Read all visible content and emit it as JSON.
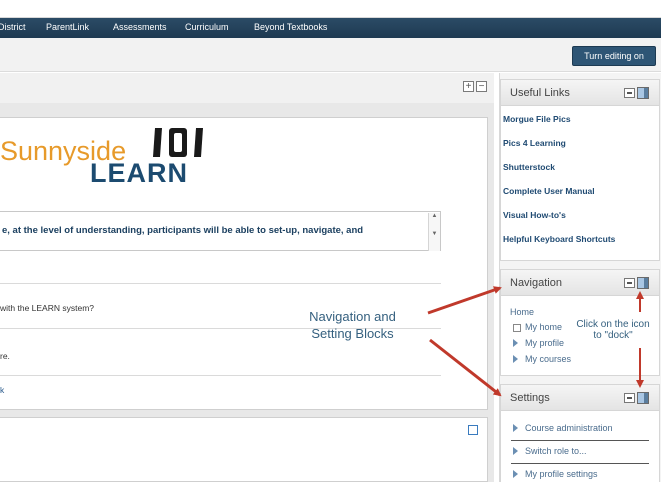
{
  "navbar": {
    "items": [
      "District",
      "ParentLink",
      "Assessments",
      "Curriculum",
      "Beyond Textbooks"
    ]
  },
  "toolbar": {
    "edit_button": "Turn editing on"
  },
  "course": {
    "logo_text_1": "Sunnyside",
    "logo_text_2": "101",
    "logo_text_3": "LEARN",
    "objective": "e, at the level of understanding, participants will be able to set-up, navigate, and",
    "question": "with the LEARN system?",
    "line_re": "re.",
    "link_k": "k"
  },
  "sidebar": {
    "useful_links": {
      "title": "Useful Links",
      "links": [
        "Morgue File Pics",
        "Pics 4 Learning",
        "Shutterstock",
        "Complete User Manual",
        "Visual How-to's",
        "Helpful Keyboard Shortcuts"
      ]
    },
    "navigation": {
      "title": "Navigation",
      "home": "Home",
      "items": [
        "My home",
        "My profile",
        "My courses"
      ]
    },
    "settings": {
      "title": "Settings",
      "items": [
        "Course administration",
        "Switch role to...",
        "My profile settings"
      ]
    }
  },
  "annotations": {
    "blocks_line1": "Navigation and",
    "blocks_line2": "Setting Blocks",
    "dock_line1": "Click on the icon",
    "dock_line2": "to \"dock\""
  },
  "colors": {
    "navbar": "#1e3a52",
    "accent_orange": "#e79a2a",
    "logo_blue": "#1c4b70",
    "arrow": "#c0392b",
    "annotation": "#35607f"
  }
}
